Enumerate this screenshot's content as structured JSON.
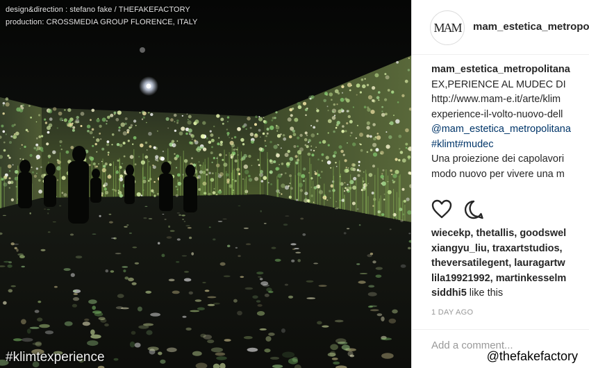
{
  "photo": {
    "credit_line1": "design&direction : stefano fake / THEFAKEFACTORY",
    "credit_line2": "production: CROSSMEDIA GROUP FLORENCE, ITALY",
    "hashtag": "#klimtexperience"
  },
  "post": {
    "username": "mam_estetica_metropolitana",
    "avatar_text": "MAM",
    "caption_username": "mam_estetica_metropolitana",
    "caption_lines": [
      "EX,PERIENCE AL MUDEC DI",
      "http://www.mam-e.it/arte/klim",
      "experience-il-volto-nuovo-dell",
      "@mam_estetica_metropolitana",
      "#klimt#mudec",
      "Una proiezione dei capolavori",
      "modo nuovo per vivere una m"
    ],
    "likes_lines": [
      "wiecekp, thetallis, goodswel",
      "xiangyu_liu, traxartstudios,",
      "theversatilegent, lauragartw",
      "lila19921992, martinkesselm"
    ],
    "likes_last_user": "siddhi5",
    "likes_suffix": " like this",
    "time": "1 DAY AGO",
    "comment_placeholder": "Add a comment..."
  },
  "watermark": "@thefakefactory",
  "icons": [
    "heart-icon",
    "comment-icon"
  ],
  "colors": {
    "link": "#003569",
    "text": "#262626",
    "muted": "#999999"
  }
}
